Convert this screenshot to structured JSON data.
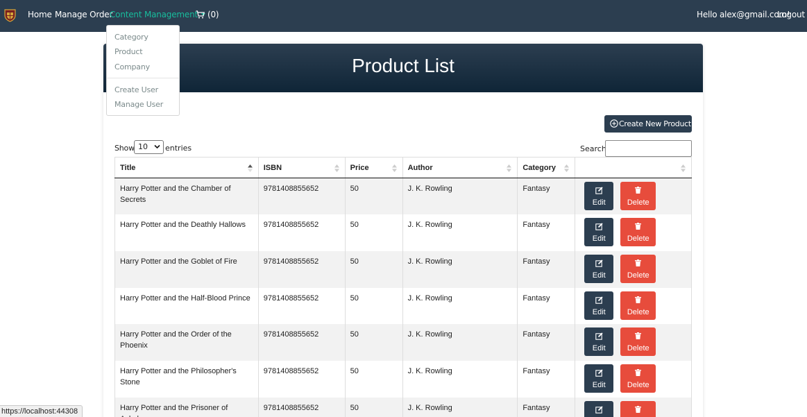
{
  "navbar": {
    "brand": "harry-potter-crest-logo",
    "links": {
      "home": "Home",
      "manage_order": "Manage Order",
      "content_management": "Content Management",
      "cart_count": "(0)"
    },
    "greeting": "Hello alex@gmail.com!",
    "logout": "Logout",
    "colors": {
      "background": "#2c3e50",
      "active": "#18bc9c"
    }
  },
  "dropdown": {
    "items": [
      "Category",
      "Product",
      "Company"
    ],
    "items2": [
      "Create User",
      "Manage User"
    ]
  },
  "page": {
    "title": "Product List",
    "create_button": "Create New Product",
    "show_label": "Show",
    "page_length": "10",
    "entries_label": "entries",
    "search_label": "Search:"
  },
  "table": {
    "columns": [
      "Title",
      "ISBN",
      "Price",
      "Author",
      "Category",
      ""
    ],
    "sorted_column": "Title",
    "edit_label": "Edit",
    "delete_label": "Delete",
    "rows": [
      {
        "title": "Harry Potter and the Chamber of Secrets",
        "isbn": "9781408855652",
        "price": "50",
        "author": "J. K. Rowling",
        "category": "Fantasy"
      },
      {
        "title": "Harry Potter and the Deathly Hallows",
        "isbn": "9781408855652",
        "price": "50",
        "author": "J. K. Rowling",
        "category": "Fantasy"
      },
      {
        "title": "Harry Potter and the Goblet of Fire",
        "isbn": "9781408855652",
        "price": "50",
        "author": "J. K. Rowling",
        "category": "Fantasy"
      },
      {
        "title": "Harry Potter and the Half-Blood Prince",
        "isbn": "9781408855652",
        "price": "50",
        "author": "J. K. Rowling",
        "category": "Fantasy"
      },
      {
        "title": "Harry Potter and the Order of the Phoenix",
        "isbn": "9781408855652",
        "price": "50",
        "author": "J. K. Rowling",
        "category": "Fantasy"
      },
      {
        "title": "Harry Potter and the Philosopher's Stone",
        "isbn": "9781408855652",
        "price": "50",
        "author": "J. K. Rowling",
        "category": "Fantasy"
      },
      {
        "title": "Harry Potter and the Prisoner of Azkaban",
        "isbn": "9781408855652",
        "price": "50",
        "author": "J. K. Rowling",
        "category": "Fantasy"
      }
    ],
    "colors": {
      "edit": "#2c3e50",
      "delete": "#e74c3c",
      "stripe": "#f2f2f2"
    }
  },
  "status_bar": {
    "url": "https://localhost:44308"
  }
}
